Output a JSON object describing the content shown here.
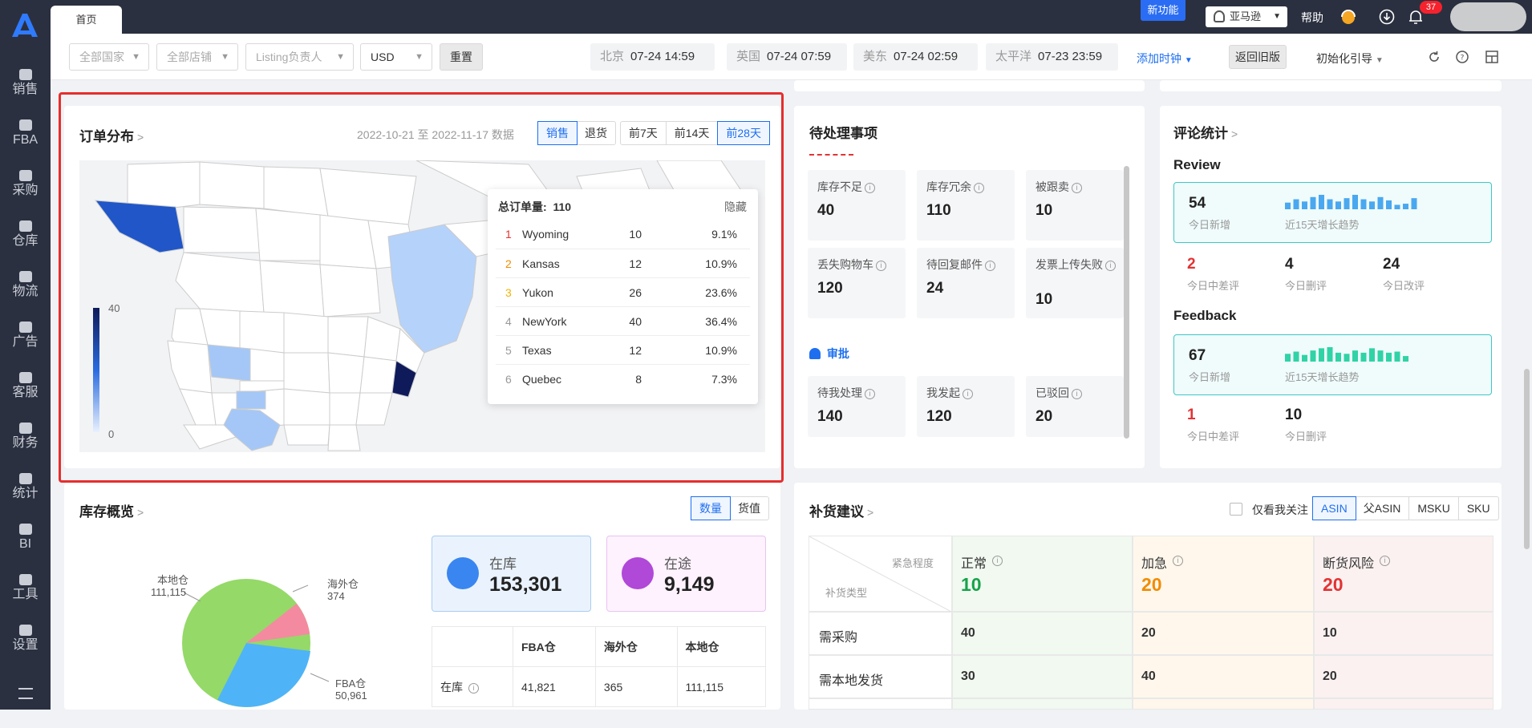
{
  "sidebar": {
    "items": [
      {
        "label": "销售",
        "icon": "sales-icon"
      },
      {
        "label": "FBA",
        "icon": "fba-icon"
      },
      {
        "label": "采购",
        "icon": "cart-icon"
      },
      {
        "label": "仓库",
        "icon": "warehouse-icon"
      },
      {
        "label": "物流",
        "icon": "truck-icon"
      },
      {
        "label": "广告",
        "icon": "ad-icon"
      },
      {
        "label": "客服",
        "icon": "mail-icon"
      },
      {
        "label": "财务",
        "icon": "yen-icon"
      },
      {
        "label": "统计",
        "icon": "pie-icon"
      },
      {
        "label": "BI",
        "icon": "bi-icon"
      },
      {
        "label": "工具",
        "icon": "wrench-icon"
      },
      {
        "label": "设置",
        "icon": "settings-icon"
      }
    ]
  },
  "topbar": {
    "tab_home": "首页",
    "new_feature": "新功能",
    "marketplace": "亚马逊",
    "help": "帮助",
    "notification_count": "37"
  },
  "filters": {
    "country": "全部国家",
    "store": "全部店铺",
    "listing_owner": "Listing负责人",
    "currency": "USD",
    "reset": "重置",
    "times": [
      {
        "city": "北京",
        "time": "07-24 14:59"
      },
      {
        "city": "英国",
        "time": "07-24 07:59"
      },
      {
        "city": "美东",
        "time": "07-24 02:59"
      },
      {
        "city": "太平洋",
        "time": "07-23 23:59"
      }
    ],
    "add_clock": "添加时钟",
    "old_version": "返回旧版",
    "init_guide": "初始化引导"
  },
  "orders": {
    "title": "订单分布",
    "date_start": "2022-10-21",
    "date_to": "至",
    "date_end": "2022-11-17",
    "date_suffix": "数据",
    "type_tabs": [
      "销售",
      "退货"
    ],
    "range_tabs": [
      "前7天",
      "前14天",
      "前28天"
    ],
    "legend_max": "40",
    "legend_min": "0",
    "tooltip_label": "总订单量:",
    "tooltip_total": "110",
    "tooltip_hide": "隐藏",
    "rows": [
      {
        "rank": "1",
        "name": "Wyoming",
        "value": "10",
        "pct": "9.1%"
      },
      {
        "rank": "2",
        "name": "Kansas",
        "value": "12",
        "pct": "10.9%"
      },
      {
        "rank": "3",
        "name": "Yukon",
        "value": "26",
        "pct": "23.6%"
      },
      {
        "rank": "4",
        "name": "NewYork",
        "value": "40",
        "pct": "36.4%"
      },
      {
        "rank": "5",
        "name": "Texas",
        "value": "12",
        "pct": "10.9%"
      },
      {
        "rank": "6",
        "name": "Quebec",
        "value": "8",
        "pct": "7.3%"
      }
    ]
  },
  "pending": {
    "title": "待处理事项",
    "tasks": [
      {
        "label": "库存不足",
        "value": "40"
      },
      {
        "label": "库存冗余",
        "value": "110"
      },
      {
        "label": "被跟卖",
        "value": "10"
      },
      {
        "label": "丢失购物车",
        "value": "120"
      },
      {
        "label": "待回复邮件",
        "value": "24"
      },
      {
        "label": "发票上传失败",
        "value": "10"
      }
    ],
    "approval_title": "审批",
    "approvals": [
      {
        "label": "待我处理",
        "value": "140"
      },
      {
        "label": "我发起",
        "value": "120"
      },
      {
        "label": "已驳回",
        "value": "20"
      }
    ]
  },
  "reviews": {
    "title": "评论统计",
    "review_heading": "Review",
    "review_new": "54",
    "review_new_label": "今日新增",
    "review_trend_label": "近15天增长趋势",
    "review_neg": "2",
    "review_neg_label": "今日中差评",
    "review_del": "4",
    "review_del_label": "今日删评",
    "review_changed": "24",
    "review_changed_label": "今日改评",
    "feedback_heading": "Feedback",
    "fb_new": "67",
    "fb_new_label": "今日新增",
    "fb_trend_label": "近15天增长趋势",
    "fb_neg": "1",
    "fb_neg_label": "今日中差评",
    "fb_del": "10",
    "fb_del_label": "今日删评",
    "review_spark": [
      6,
      9,
      7,
      11,
      13,
      9,
      7,
      10,
      13,
      9,
      7,
      11,
      8,
      4,
      5,
      10
    ],
    "fb_spark": [
      7,
      9,
      6,
      10,
      12,
      13,
      8,
      7,
      10,
      8,
      12,
      10,
      8,
      9,
      5
    ]
  },
  "inventory": {
    "title": "库存概览",
    "tabs": [
      "数量",
      "货值"
    ],
    "pie": [
      {
        "name": "本地仓",
        "value": "111,115"
      },
      {
        "name": "海外仓",
        "value": "374"
      },
      {
        "name": "FBA仓",
        "value": "50,961"
      }
    ],
    "in_stock_label": "在库",
    "in_stock": "153,301",
    "in_transit_label": "在途",
    "in_transit": "9,149",
    "table_headers": [
      "",
      "FBA仓",
      "海外仓",
      "本地仓"
    ],
    "row_label": "在库",
    "row_values": [
      "41,821",
      "365",
      "111,115"
    ]
  },
  "replenish": {
    "title": "补货建议",
    "only_follow": "仅看我关注",
    "tabs": [
      "ASIN",
      "父ASIN",
      "MSKU",
      "SKU"
    ],
    "corner_top": "紧急程度",
    "corner_bottom": "补货类型",
    "cols": [
      {
        "label": "正常",
        "value": "10"
      },
      {
        "label": "加急",
        "value": "20"
      },
      {
        "label": "断货风险",
        "value": "20"
      }
    ],
    "rows": [
      {
        "label": "需采购",
        "values": [
          "40",
          "20",
          "10"
        ]
      },
      {
        "label": "需本地发货",
        "values": [
          "30",
          "40",
          "20"
        ]
      }
    ]
  },
  "colors": {
    "accent": "#1e6ff0",
    "sidebar": "#2b3040",
    "normal": "#17a34a",
    "urgent": "#f08c00",
    "risk": "#e33333"
  }
}
